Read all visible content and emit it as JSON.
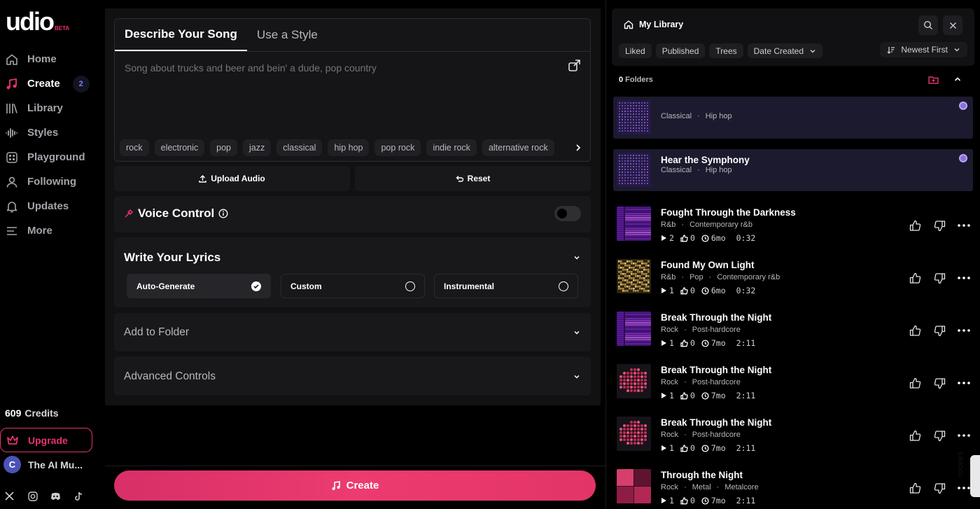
{
  "brand": {
    "logo": "udio",
    "beta": "BETA"
  },
  "nav": [
    {
      "label": "Home",
      "icon": "home-icon"
    },
    {
      "label": "Create",
      "icon": "music-note-icon",
      "badge": "2",
      "active": true
    },
    {
      "label": "Library",
      "icon": "library-icon"
    },
    {
      "label": "Styles",
      "icon": "waveform-icon"
    },
    {
      "label": "Playground",
      "icon": "playground-icon"
    },
    {
      "label": "Following",
      "icon": "user-icon"
    },
    {
      "label": "Updates",
      "icon": "bell-icon"
    },
    {
      "label": "More",
      "icon": "menu-icon"
    }
  ],
  "credits": {
    "amount": "609",
    "label": "Credits"
  },
  "upgrade_label": "Upgrade",
  "user": {
    "initial": "C",
    "name": "The AI Mu..."
  },
  "create_panel": {
    "tabs": [
      "Describe Your Song",
      "Use a Style"
    ],
    "prompt_placeholder": "Song about trucks and beer and bein' a dude, pop country",
    "chips": [
      "rock",
      "electronic",
      "pop",
      "jazz",
      "classical",
      "hip hop",
      "pop rock",
      "indie rock",
      "alternative rock"
    ],
    "upload_label": "Upload Audio",
    "reset_label": "Reset",
    "voice_control": "Voice Control",
    "lyrics": {
      "title": "Write Your Lyrics",
      "options": [
        {
          "label": "Auto-Generate",
          "selected": true
        },
        {
          "label": "Custom",
          "selected": false
        },
        {
          "label": "Instrumental",
          "selected": false
        }
      ]
    },
    "add_folder": "Add to Folder",
    "advanced": "Advanced Controls",
    "create_button": "Create"
  },
  "library": {
    "title": "My Library",
    "filters": [
      "Liked",
      "Published",
      "Trees",
      "Date Created"
    ],
    "sort": "Newest First",
    "folders_count": "0",
    "folders_label": "Folders",
    "tracks": [
      {
        "title": "",
        "tags": [
          "Classical",
          "Hip hop"
        ],
        "plays": "",
        "likes": "",
        "age": "",
        "duration": "",
        "selected": true,
        "cover": "dots-purple"
      },
      {
        "title": "Hear the Symphony",
        "tags": [
          "Classical",
          "Hip hop"
        ],
        "plays": "",
        "likes": "",
        "age": "",
        "duration": "",
        "selected": true,
        "cover": "dots-purple"
      },
      {
        "title": "Fought Through the Darkness",
        "tags": [
          "R&b",
          "Contemporary r&b"
        ],
        "plays": "2",
        "likes": "0",
        "age": "6mo",
        "duration": "0:32",
        "cover": "bars-purple"
      },
      {
        "title": "Found My Own Light",
        "tags": [
          "R&b",
          "Pop",
          "Contemporary r&b"
        ],
        "plays": "1",
        "likes": "0",
        "age": "6mo",
        "duration": "0:32",
        "cover": "gold"
      },
      {
        "title": "Break Through the Night",
        "tags": [
          "Rock",
          "Post-hardcore"
        ],
        "plays": "1",
        "likes": "0",
        "age": "7mo",
        "duration": "2:11",
        "cover": "bars-purple"
      },
      {
        "title": "Break Through the Night",
        "tags": [
          "Rock",
          "Post-hardcore"
        ],
        "plays": "1",
        "likes": "0",
        "age": "7mo",
        "duration": "2:11",
        "cover": "dots-pink"
      },
      {
        "title": "Break Through the Night",
        "tags": [
          "Rock",
          "Post-hardcore"
        ],
        "plays": "1",
        "likes": "0",
        "age": "7mo",
        "duration": "2:11",
        "cover": "dots-pink"
      },
      {
        "title": "Through the Night",
        "tags": [
          "Rock",
          "Metal",
          "Metalcore"
        ],
        "plays": "1",
        "likes": "0",
        "age": "7mo",
        "duration": "2:11",
        "cover": "squares-pink"
      }
    ]
  },
  "cookie_label": "COOKIES",
  "colors": {
    "accent": "#e6336e",
    "highlight": "#1c1a2e",
    "panel": "#111113"
  }
}
